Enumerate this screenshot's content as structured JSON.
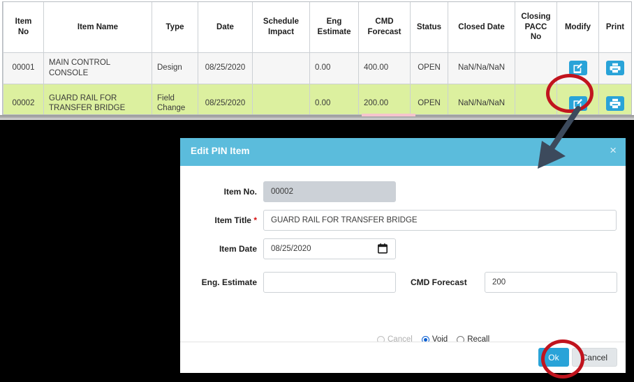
{
  "table": {
    "name": "pin-items-grid",
    "columns": [
      {
        "key": "item_no",
        "label": "Item\nNo"
      },
      {
        "key": "item_name",
        "label": "Item Name"
      },
      {
        "key": "type",
        "label": "Type"
      },
      {
        "key": "date",
        "label": "Date"
      },
      {
        "key": "schedule_impact",
        "label": "Schedule\nImpact"
      },
      {
        "key": "eng_estimate",
        "label": "Eng\nEstimate"
      },
      {
        "key": "cmd_forecast",
        "label": "CMD\nForecast"
      },
      {
        "key": "status",
        "label": "Status"
      },
      {
        "key": "closed_date",
        "label": "Closed Date"
      },
      {
        "key": "closing_pacc_no",
        "label": "Closing\nPACC\nNo"
      },
      {
        "key": "modify",
        "label": "Modify"
      },
      {
        "key": "print",
        "label": "Print"
      }
    ],
    "headers": {
      "item_no_l1": "Item",
      "item_no_l2": "No",
      "item_name": "Item Name",
      "type": "Type",
      "date": "Date",
      "schedule_l1": "Schedule",
      "schedule_l2": "Impact",
      "eng_l1": "Eng",
      "eng_l2": "Estimate",
      "cmd_l1": "CMD",
      "cmd_l2": "Forecast",
      "status": "Status",
      "closed_date": "Closed Date",
      "pacc_l1": "Closing",
      "pacc_l2": "PACC",
      "pacc_l3": "No",
      "modify": "Modify",
      "print": "Print"
    },
    "rows": [
      {
        "item_no": "00001",
        "item_name": "MAIN CONTROL CONSOLE",
        "type": "Design",
        "date": "08/25/2020",
        "schedule_impact": "",
        "eng_estimate": "0.00",
        "cmd_forecast": "400.00",
        "status": "OPEN",
        "closed_date": "NaN/Na/NaN",
        "closing_pacc_no": "",
        "modify_icon": "edit-square-icon",
        "print_icon": "printer-icon",
        "highlighted": false
      },
      {
        "item_no": "00002",
        "item_name_l1": "GUARD RAIL FOR",
        "item_name_l2": "TRANSFER BRIDGE",
        "item_name": "GUARD RAIL FOR TRANSFER BRIDGE",
        "type_l1": "Field",
        "type_l2": "Change",
        "type": "Field Change",
        "date": "08/25/2020",
        "schedule_impact": "",
        "eng_estimate": "0.00",
        "cmd_forecast": "200.00",
        "status": "OPEN",
        "closed_date": "NaN/Na/NaN",
        "closing_pacc_no": "",
        "modify_icon": "edit-square-icon",
        "print_icon": "printer-icon",
        "highlighted": true
      }
    ]
  },
  "modal": {
    "title": "Edit PIN Item",
    "close_label": "×",
    "fields": {
      "item_no": {
        "label": "Item No.",
        "value": "00002",
        "readonly": true
      },
      "item_title": {
        "label": "Item Title",
        "required_mark": "*",
        "value": "GUARD RAIL FOR TRANSFER BRIDGE"
      },
      "item_date": {
        "label": "Item Date",
        "value": "08/25/2020",
        "icon": "calendar-icon"
      },
      "eng_estimate": {
        "label": "Eng. Estimate",
        "value": "",
        "placeholder": ""
      },
      "cmd_forecast": {
        "label": "CMD Forecast",
        "value": "200",
        "placeholder": ""
      }
    },
    "radios": [
      {
        "label": "Cancel",
        "checked": false,
        "disabled": true
      },
      {
        "label": "Void",
        "checked": true,
        "disabled": false
      },
      {
        "label": "Recall",
        "checked": false,
        "disabled": false
      }
    ],
    "footer": {
      "ok_label": "Ok",
      "cancel_label": "Cancel"
    }
  },
  "annotations": {
    "highlight_color": "#c1141e",
    "arrow_color": "#3c4a5c",
    "modify_button_circle": "modify-button-highlight",
    "ok_button_circle": "ok-button-highlight",
    "arrow": "pointer-arrow"
  },
  "colors": {
    "accent_cyan": "#5bbcdc",
    "icon_blue": "#29a3d8",
    "row_highlight_green": "#dcf09f",
    "row_alt_gray": "#f6f6f6",
    "annotation_red": "#c1141e",
    "required_red": "#d81010",
    "readonly_gray": "#ccd1d7"
  }
}
